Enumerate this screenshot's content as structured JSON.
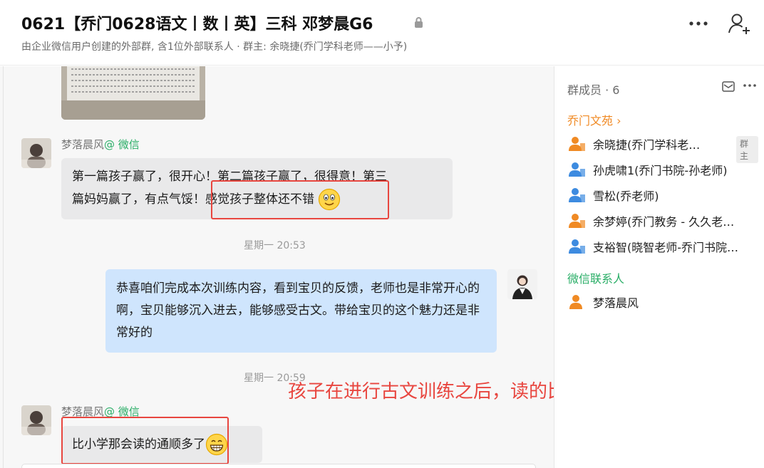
{
  "header": {
    "title": "0621【乔门0628语文丨数丨英】三科 邓梦晨G6",
    "subtitle": "由企业微信用户创建的外部群, 含1位外部联系人 · 群主: 余晓捷(乔门学科老师——小予)"
  },
  "chat": {
    "messages": [
      {
        "sender": "梦落晨风",
        "source": "@ 微信",
        "text_line1": "第一篇孩子赢了，很开心！第二篇孩子赢了，很得意！第三",
        "text_line2": "篇妈妈赢了，有点气馁！感觉孩子整体还不错"
      },
      {
        "time": "星期一 20:53"
      },
      {
        "text": "恭喜咱们完成本次训练内容，看到宝贝的反馈，老师也是非常开心的啊，宝贝能够沉入进去，能够感受古文。带给宝贝的这个魅力还是非常好的"
      },
      {
        "time": "星期一 20:59"
      },
      {
        "sender": "梦落晨风",
        "source": "@ 微信",
        "text": "比小学那会读的通顺多了"
      }
    ],
    "annotation": "孩子在进行古文训练之后，读的比小学的时候通顺了"
  },
  "panel": {
    "title": "群成员 · 6",
    "section_org": "乔门文苑 ›",
    "members": [
      {
        "name": "余晓捷(乔门学科老…",
        "badge": "群主",
        "icon_color": "#f08a24"
      },
      {
        "name": "孙虎啸1(乔门书院-孙老师)",
        "icon_color": "#3d8be0"
      },
      {
        "name": "雪松(乔老师)",
        "icon_color": "#3d8be0"
      },
      {
        "name": "余梦婷(乔门教务 - 久久老…",
        "icon_color": "#f08a24"
      },
      {
        "name": "支裕智(晓智老师-乔门书院…",
        "icon_color": "#3d8be0"
      }
    ],
    "section_wechat": "微信联系人",
    "wechat_members": [
      {
        "name": "梦落晨风",
        "icon_color": "#f08a24"
      }
    ]
  },
  "colors": {
    "accent_orange": "#f08a24",
    "wechat_green": "#2aae67",
    "annotation_red": "#e8463f",
    "outgoing_bubble": "#cfe5fd",
    "incoming_bubble": "#e9e9ea"
  }
}
